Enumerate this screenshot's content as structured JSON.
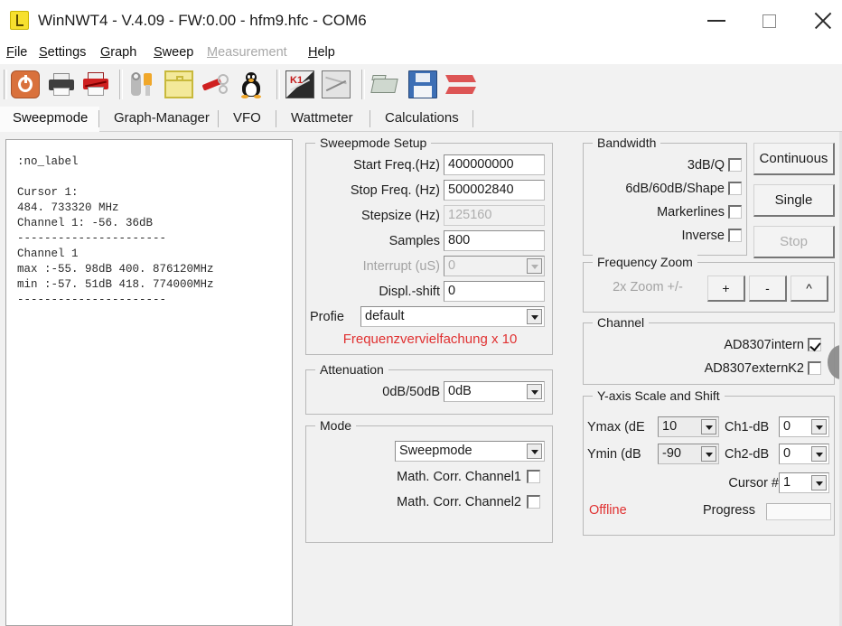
{
  "window": {
    "title": "WinNWT4 - V.4.09 - FW:0.00 - hfm9.hfc - COM6",
    "minimize_label": "Minimize",
    "maximize_label": "Maximize",
    "close_label": "Close"
  },
  "menu": [
    {
      "label": "File",
      "mnemonic": "F",
      "disabled": false
    },
    {
      "label": "Settings",
      "mnemonic": "S",
      "disabled": false
    },
    {
      "label": "Graph",
      "mnemonic": "G",
      "disabled": false
    },
    {
      "label": "Sweep",
      "mnemonic": "S",
      "disabled": false
    },
    {
      "label": "Measurement",
      "mnemonic": "M",
      "disabled": true
    },
    {
      "label": "Help",
      "mnemonic": "H",
      "disabled": false
    }
  ],
  "toolbar": {
    "icons": [
      "power-icon",
      "print-icon",
      "print-cancel-icon",
      "settings-tools-icon",
      "case-icon",
      "calibration-icon",
      "linux-penguin-icon",
      "chart-k1-icon",
      "chart-icon",
      "open-file-icon",
      "save-file-icon",
      "export-icon"
    ]
  },
  "tabs": [
    {
      "label": "Sweepmode",
      "active": true
    },
    {
      "label": "Graph-Manager",
      "active": false
    },
    {
      "label": "VFO",
      "active": false
    },
    {
      "label": "Wattmeter",
      "active": false
    },
    {
      "label": "Calculations",
      "active": false
    }
  ],
  "log": ":no_label\n\nCursor 1:\n484. 733320 MHz\nChannel 1: -56. 36dB\n----------------------\nChannel 1\nmax :-55. 98dB 400. 876120MHz\nmin :-57. 51dB 418. 774000MHz\n----------------------",
  "sweepmode_setup": {
    "caption": "Sweepmode Setup",
    "fields": [
      {
        "label": "Start Freq.(Hz)",
        "value": "400000000",
        "disabled": false,
        "type": "text"
      },
      {
        "label": "Stop Freq. (Hz)",
        "value": "500002840",
        "disabled": false,
        "type": "text"
      },
      {
        "label": "Stepsize (Hz)",
        "value": "125160",
        "disabled": true,
        "type": "text"
      },
      {
        "label": "Samples",
        "value": "800",
        "disabled": false,
        "type": "text"
      },
      {
        "label": "Interrupt (uS)",
        "value": "0",
        "disabled": true,
        "type": "combo"
      },
      {
        "label": "Displ.-shift",
        "value": "0",
        "disabled": false,
        "type": "text"
      },
      {
        "label": "Profie",
        "value": "default",
        "disabled": false,
        "type": "combo"
      }
    ],
    "note": "Frequenzvervielfachung x 10"
  },
  "attenuation": {
    "caption": "Attenuation",
    "label": "0dB/50dB",
    "value": "0dB"
  },
  "mode": {
    "caption": "Mode",
    "value": "Sweepmode",
    "checkboxes": [
      {
        "label": "Math. Corr. Channel1",
        "checked": false
      },
      {
        "label": "Math. Corr. Channel2",
        "checked": false
      }
    ]
  },
  "bandwidth": {
    "caption": "Bandwidth",
    "checkboxes": [
      {
        "label": "3dB/Q",
        "checked": false
      },
      {
        "label": "6dB/60dB/Shape",
        "checked": false
      },
      {
        "label": "Markerlines",
        "checked": false
      },
      {
        "label": "Inverse",
        "checked": false
      }
    ]
  },
  "run_buttons": [
    {
      "label": "Continuous",
      "disabled": false
    },
    {
      "label": "Single",
      "disabled": false
    },
    {
      "label": "Stop",
      "disabled": true
    }
  ],
  "frequency_zoom": {
    "caption": "Frequency Zoom",
    "label": "2x Zoom +/-",
    "buttons": [
      {
        "label": "+"
      },
      {
        "label": "-"
      },
      {
        "label": "^"
      }
    ]
  },
  "channel": {
    "caption": "Channel",
    "checkboxes": [
      {
        "label": "AD8307intern",
        "checked": true
      },
      {
        "label": "AD8307externK2",
        "checked": false
      }
    ]
  },
  "yaxis": {
    "caption": "Y-axis Scale and Shift",
    "ymax_label": "Ymax (dE",
    "ymax_value": "10",
    "ymin_label": "Ymin (dB",
    "ymin_value": "-90",
    "ch1_label": "Ch1-dB",
    "ch1_value": "0",
    "ch2_label": "Ch2-dB",
    "ch2_value": "0",
    "cursor_label": "Cursor #",
    "cursor_value": "1",
    "status": "Offline",
    "progress_label": "Progress"
  },
  "colors": {
    "accent_red": "#e03131",
    "window_bg": "#f1f1f1",
    "panel_bg": "#ffffff"
  }
}
